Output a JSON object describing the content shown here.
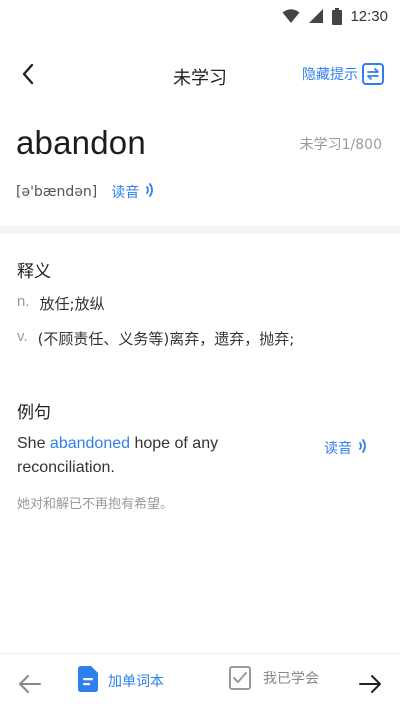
{
  "status_bar": {
    "time": "12:30"
  },
  "nav": {
    "title": "未学习",
    "hint_label": "隐藏提示"
  },
  "word": {
    "headword": "abandon",
    "progress": "未学习1/800",
    "phonetic": "[ə'bændən]",
    "read_label": "读音"
  },
  "definitions": {
    "title": "释义",
    "items": [
      {
        "pos": "n.",
        "text": "放任;放纵"
      },
      {
        "pos": "v.",
        "text": "(不顾责任、义务等)离弃，遗弃，抛弃;"
      }
    ]
  },
  "example": {
    "title": "例句",
    "before": "She ",
    "highlight": "abandoned",
    "after": " hope of any reconciliation.",
    "read_label": "读音",
    "translation": "她对和解已不再抱有希望。"
  },
  "bottom_bar": {
    "add_label": "加单词本",
    "learned_label": "我已学会"
  },
  "colors": {
    "accent": "#2f80ed",
    "muted": "#9a9a9a"
  },
  "icons": [
    "wifi-icon",
    "signal-icon",
    "battery-icon",
    "back-arrow-icon",
    "hint-toggle-icon",
    "speaker-icon",
    "arrow-left-icon",
    "document-icon",
    "checkbox-icon",
    "arrow-right-icon"
  ]
}
